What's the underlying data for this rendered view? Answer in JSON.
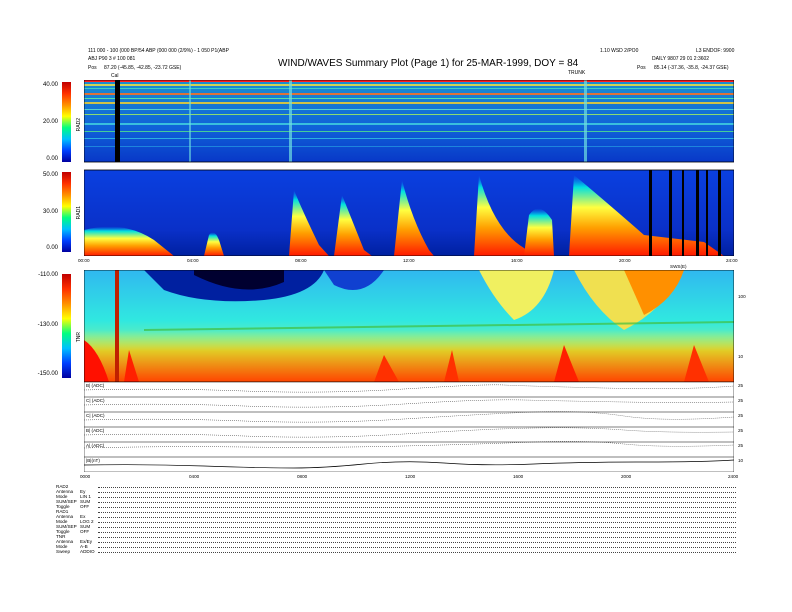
{
  "header": {
    "title": "WIND/WAVES Summary Plot (Page 1) for 25-MAR-1999, DOY = 84",
    "left_line1": "111 000 - 100 (000 BP/54 ABP (000 000 (2/9%) - 1 050 P1(ABP",
    "left_line2": "ABJ P90 3 # 100 081",
    "left_line3_label": "Pos",
    "left_line3_value": "87.20 (-45.85, -42.85, -23.72 GSE)",
    "center_right": "1.10 WSD 2/PO0",
    "center_right2": "TRUNK",
    "right_line1": "L3 ENDOF: 9900",
    "right_line2": "DAILY 9807 29 01 2:3602",
    "right_line3_label": "Pos",
    "right_line3_value": "85.14 (-37.36, -35.8, -24.37 GSE)",
    "cal_marker": "Cal"
  },
  "panels": {
    "rad2": {
      "name": "RAD2",
      "ticks": [
        "40.00",
        "20.00",
        "0.00"
      ]
    },
    "rad1": {
      "name": "RAD1",
      "ticks": [
        "50.00",
        "30.00",
        "0.00"
      ]
    },
    "tnr": {
      "name": "TNR",
      "ticks": [
        "-110.00",
        "-130.00",
        "-150.00"
      ],
      "right_ticks": [
        "100",
        "10"
      ]
    },
    "time_ticks_top": [
      "00:00",
      "04:00",
      "08:00",
      "12:00",
      "16:00",
      "20:00",
      "24:00"
    ],
    "time_ticks_bottom": [
      "0000",
      "0400",
      "0800",
      "1200",
      "1600",
      "2000",
      "2400"
    ],
    "mid_label": "SWS(E)"
  },
  "lineplots": [
    {
      "label": "B| (ADC)",
      "right": "25"
    },
    {
      "label": "C| (ADC)",
      "right": "25"
    },
    {
      "label": "C| (ADC)",
      "right": "25"
    },
    {
      "label": "B| (ADC)",
      "right": "25"
    },
    {
      "label": "A| (ADC)",
      "right": "25"
    },
    {
      "label": "|B|(nT)",
      "right": "10"
    }
  ],
  "status": [
    {
      "k": "RAD2",
      "v": ""
    },
    {
      "k": "Antenna",
      "v": "Ey"
    },
    {
      "k": "Mode",
      "v": "LIN 1"
    },
    {
      "k": "SUM/SEP",
      "v": "SUM"
    },
    {
      "k": "Toggle",
      "v": "OFF"
    },
    {
      "k": "RAD1",
      "v": ""
    },
    {
      "k": "Antenna",
      "v": "Ex"
    },
    {
      "k": "Mode",
      "v": "LOG 2"
    },
    {
      "k": "SUM/SEP",
      "v": "SUM"
    },
    {
      "k": "Toggle",
      "v": "OFF"
    },
    {
      "k": "TNR",
      "v": ""
    },
    {
      "k": "Antenna",
      "v": "Ex/Ey"
    },
    {
      "k": "Mode",
      "v": "A-B"
    },
    {
      "k": "Sweep",
      "v": "ADDIO"
    }
  ]
}
